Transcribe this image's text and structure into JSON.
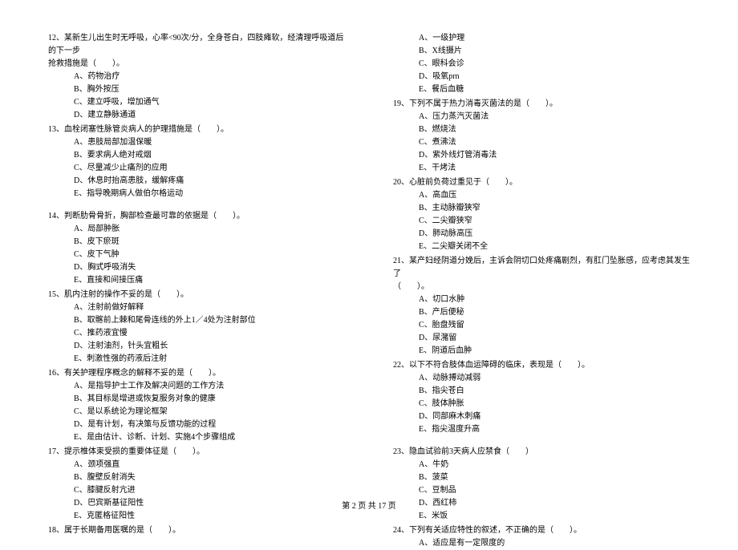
{
  "left_column": {
    "q12": {
      "line1": "12、某新生儿出生时无呼吸，心率<90次/分，全身苍白，四肢瘫软，经清理呼吸道后的下一步",
      "line2": "抢救措施是（　　）。",
      "opts": [
        "A、药物治疗",
        "B、胸外按压",
        "C、建立呼吸，增加通气",
        "D、建立静脉通道"
      ]
    },
    "q13": {
      "text": "13、血栓闭塞性脉管炎病人的护理措施是（　　）。",
      "opts": [
        "A、患肢局部加温保暖",
        "B、要求病人绝对戒烟",
        "C、尽量减少止痛剂的应用",
        "D、休息时抬高患肢，缓解疼痛",
        "E、指导晚期病人做伯尔格运动"
      ]
    },
    "q14": {
      "text": "14、判断肋骨骨折，胸部检查最可靠的依据是（　　）。",
      "opts": [
        "A、局部肿胀",
        "B、皮下瘀斑",
        "C、皮下气肿",
        "D、胸式呼吸消失",
        "E、直接和间接压痛"
      ]
    },
    "q15": {
      "text": "15、肌内注射的操作不妥的是（　　）。",
      "opts": [
        "A、注射前做好解释",
        "B、取髂前上棘和尾骨连线的外上1／4处为注射部位",
        "C、推药液宜慢",
        "D、注射油剂，针头宜粗长",
        "E、刺激性强的药液后注射"
      ]
    },
    "q16": {
      "text": "16、有关护理程序概念的解释不妥的是（　　）。",
      "opts": [
        "A、是指导护士工作及解决问题的工作方法",
        "B、其目标是增进或恢复服务对象的健康",
        "C、是以系统论为理论框架",
        "D、是有计划，有决策与反馈功能的过程",
        "E、是由估计、诊断、计划、实施4个步骤组成"
      ]
    },
    "q17": {
      "text": "17、提示椎体束受损的重要体征是（　　）。",
      "opts": [
        "A、颈项强直",
        "B、腹壁反射消失",
        "C、膝腱反射亢进",
        "D、巴宾斯基征阳性",
        "E、克匿格征阳性"
      ]
    },
    "q18": {
      "text": "18、属于长期备用医嘱的是（　　）。"
    }
  },
  "right_column": {
    "q18_opts": [
      "A、一级护理",
      "B、X线摄片",
      "C、眼科会诊",
      "D、吸氧prn",
      "E、餐后血糖"
    ],
    "q19": {
      "text": "19、下列不属于热力消毒灭菌法的是（　　）。",
      "opts": [
        "A、压力蒸汽灭菌法",
        "B、燃烧法",
        "C、煮沸法",
        "D、紫外线灯管消毒法",
        "E、干烤法"
      ]
    },
    "q20": {
      "text": "20、心脏前负荷过重见于（　　）。",
      "opts": [
        "A、高血压",
        "B、主动脉瓣狭窄",
        "C、二尖瓣狭窄",
        "D、肺动脉高压",
        "E、二尖瓣关闭不全"
      ]
    },
    "q21": {
      "line1": "21、某产妇经阴道分娩后，主诉会阴切口处疼痛剧烈，有肛门坠胀感，应考虑其发生了",
      "line2": "（　　）。",
      "opts": [
        "A、切口水肿",
        "B、产后便秘",
        "C、胎盘残留",
        "D、尿潴留",
        "E、阴道后血肿"
      ]
    },
    "q22": {
      "text": "22、以下不符合肢体血运障碍的临床，表现是（　　）。",
      "opts": [
        "A、动脉搏动减弱",
        "B、指尖苍白",
        "C、肢体肿胀",
        "D、同部麻木刺痛",
        "E、指尖温度升高"
      ]
    },
    "q23": {
      "text": "23、隐血试验前3天病人应禁食（　　）",
      "opts": [
        "A、牛奶",
        "B、菠菜",
        "C、豆制品",
        "D、西红柿",
        "E、米饭"
      ]
    },
    "q24": {
      "text": "24、下列有关适应特性的叙述，不正确的是（　　）。",
      "opts": [
        "A、适应是有一定限度的"
      ]
    }
  },
  "footer": "第 2 页 共 17 页"
}
